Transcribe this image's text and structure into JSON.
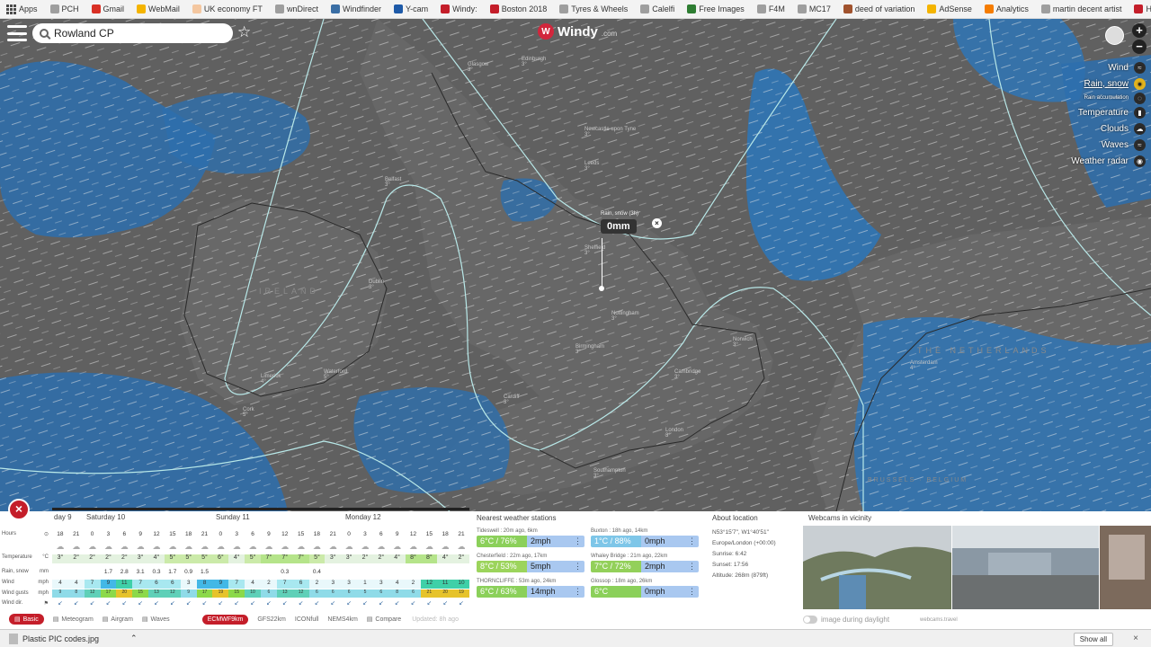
{
  "bookmarks": [
    {
      "label": "Apps",
      "color": "#4a4a4a",
      "icon": "apps-grid-icon"
    },
    {
      "label": "PCH",
      "color": "#9e9e9e",
      "icon": "page-icon"
    },
    {
      "label": "Gmail",
      "color": "#d93025",
      "icon": "gmail-icon"
    },
    {
      "label": "WebMail",
      "color": "#f4b400",
      "icon": "webmail-icon"
    },
    {
      "label": "UK economy FT",
      "color": "#f4c7a0",
      "icon": "ft-icon"
    },
    {
      "label": "wnDirect",
      "color": "#9e9e9e",
      "icon": "page-icon"
    },
    {
      "label": "Windfinder",
      "color": "#3a6ea5",
      "icon": "windfinder-icon"
    },
    {
      "label": "Y-cam",
      "color": "#1e5aa8",
      "icon": "ycam-icon"
    },
    {
      "label": "Windy:",
      "color": "#c41e2a",
      "icon": "windy-icon"
    },
    {
      "label": "Boston 2018",
      "color": "#c41e2a",
      "icon": "map-pin-icon"
    },
    {
      "label": "Tyres & Wheels",
      "color": "#9e9e9e",
      "icon": "page-icon"
    },
    {
      "label": "Calelfi",
      "color": "#9e9e9e",
      "icon": "page-icon"
    },
    {
      "label": "Free Images",
      "color": "#2e7d32",
      "icon": "images-icon"
    },
    {
      "label": "F4M",
      "color": "#9e9e9e",
      "icon": "page-icon"
    },
    {
      "label": "MC17",
      "color": "#9e9e9e",
      "icon": "page-icon"
    },
    {
      "label": "deed of variation",
      "color": "#a0522d",
      "icon": "deed-icon"
    },
    {
      "label": "AdSense",
      "color": "#f4b400",
      "icon": "adsense-icon"
    },
    {
      "label": "Analytics",
      "color": "#f57c00",
      "icon": "analytics-icon"
    },
    {
      "label": "martin decent artist",
      "color": "#9e9e9e",
      "icon": "page-icon"
    },
    {
      "label": "How to set up a rout",
      "color": "#c41e2a",
      "icon": "poa-icon"
    }
  ],
  "search": {
    "value": "Rowland CP"
  },
  "logo": {
    "text": "Windy",
    "suffix": ".com"
  },
  "zoom": {
    "in": "+",
    "out": "−"
  },
  "layers": [
    {
      "label": "Wind",
      "icon": "wind-icon",
      "glyph": "≈",
      "active": false,
      "small": false
    },
    {
      "label": "Rain, snow",
      "icon": "rain-drop-icon",
      "glyph": "●",
      "active": true,
      "small": false
    },
    {
      "label": "Rain accumulation",
      "icon": "rain-accumulation-icon",
      "glyph": "◌",
      "active": false,
      "small": true
    },
    {
      "label": "Temperature",
      "icon": "thermometer-icon",
      "glyph": "▮",
      "active": false,
      "small": false
    },
    {
      "label": "Clouds",
      "icon": "cloud-icon",
      "glyph": "☁",
      "active": false,
      "small": false
    },
    {
      "label": "Waves",
      "icon": "waves-icon",
      "glyph": "≈",
      "active": false,
      "small": false
    },
    {
      "label": "Weather radar",
      "icon": "radar-icon",
      "glyph": "◉",
      "active": false,
      "small": false
    }
  ],
  "popup": {
    "title": "Rain, snow (3h)",
    "value": "0mm",
    "close": "×"
  },
  "map_labels": {
    "countries": [
      "IRELAND",
      "THE NETHERLANDS",
      "BRUSSELS · BELGIUM"
    ],
    "cities": [
      {
        "name": "Glasgow",
        "temp": "3°"
      },
      {
        "name": "Edinburgh",
        "temp": "3°"
      },
      {
        "name": "Newcastle upon Tyne",
        "temp": "3°"
      },
      {
        "name": "Belfast",
        "temp": "3°"
      },
      {
        "name": "Leeds",
        "temp": "3°"
      },
      {
        "name": "Sheffield",
        "temp": "3°"
      },
      {
        "name": "Dublin",
        "temp": "3°"
      },
      {
        "name": "Nottingham",
        "temp": "3°"
      },
      {
        "name": "Birmingham",
        "temp": "3°"
      },
      {
        "name": "Cardiff",
        "temp": "3°"
      },
      {
        "name": "London",
        "temp": "3°"
      },
      {
        "name": "Cork",
        "temp": "5°"
      },
      {
        "name": "Amsterdam",
        "temp": "4°"
      },
      {
        "name": "Norwich",
        "temp": "3°"
      },
      {
        "name": "Cambridge",
        "temp": "3°"
      },
      {
        "name": "Limerick",
        "temp": "4°"
      },
      {
        "name": "Waterford",
        "temp": "5°"
      },
      {
        "name": "Southampton",
        "temp": "3°"
      }
    ]
  },
  "forecast": {
    "close": "×",
    "days": [
      "day 9",
      "Saturday 10",
      "Sunday 11",
      "Monday 12"
    ],
    "row_labels": [
      {
        "name": "Hours",
        "unit": "⊙"
      },
      {
        "name": "Temperature",
        "unit": "°C"
      },
      {
        "name": "Rain, snow",
        "unit": "mm"
      },
      {
        "name": "Wind",
        "unit": "mph"
      },
      {
        "name": "Wind gusts",
        "unit": "mph"
      },
      {
        "name": "Wind dir.",
        "unit": "⚑"
      }
    ],
    "hours": [
      "18",
      "21",
      "0",
      "3",
      "6",
      "9",
      "12",
      "15",
      "18",
      "21",
      "0",
      "3",
      "6",
      "9",
      "12",
      "15",
      "18",
      "21",
      "0",
      "3",
      "6",
      "9",
      "12",
      "15",
      "18",
      "21"
    ],
    "temps": [
      "3°",
      "2°",
      "2°",
      "2°",
      "2°",
      "3°",
      "4°",
      "5°",
      "5°",
      "5°",
      "6°",
      "4°",
      "5°",
      "7°",
      "7°",
      "7°",
      "5°",
      "3°",
      "3°",
      "2°",
      "2°",
      "4°",
      "8°",
      "8°",
      "4°",
      "2°"
    ],
    "rain": [
      "",
      "",
      "",
      "1.7",
      "2.8",
      "3.1",
      "0.3",
      "1.7",
      "0.9",
      "1.5",
      "",
      "",
      "",
      "",
      "0.3",
      "",
      "0.4",
      "",
      "",
      "",
      "",
      "",
      "",
      "",
      "",
      ""
    ],
    "wind": [
      "4",
      "4",
      "7",
      "9",
      "11",
      "7",
      "6",
      "6",
      "3",
      "8",
      "9",
      "7",
      "4",
      "2",
      "7",
      "6",
      "2",
      "3",
      "3",
      "1",
      "3",
      "4",
      "2",
      "12",
      "11",
      "10"
    ],
    "gusts": [
      "9",
      "8",
      "12",
      "17",
      "20",
      "15",
      "13",
      "12",
      "9",
      "17",
      "19",
      "15",
      "10",
      "6",
      "13",
      "12",
      "6",
      "6",
      "6",
      "5",
      "6",
      "8",
      "6",
      "21",
      "20",
      "19"
    ]
  },
  "stations": {
    "title": "Nearest weather stations",
    "items": [
      {
        "name": "Tideswell : 20m ago, 6km",
        "temp": "6°C / 76%",
        "wind": "2mph",
        "color": "#8bd05a"
      },
      {
        "name": "Buxton : 18h ago, 14km",
        "temp": "1°C / 88%",
        "wind": "0mph",
        "color": "#7ec6e8"
      },
      {
        "name": "Chesterfield : 22m ago, 17km",
        "temp": "8°C / 53%",
        "wind": "5mph",
        "color": "#9cd45c"
      },
      {
        "name": "Whaley Bridge : 21m ago, 22km",
        "temp": "7°C / 72%",
        "wind": "2mph",
        "color": "#93d05a"
      },
      {
        "name": "THORNCLIFFE : 53m ago, 24km",
        "temp": "6°C / 63%",
        "wind": "14mph",
        "color": "#8bd05a"
      },
      {
        "name": "Glossop : 18m ago, 26km",
        "temp": "6°C",
        "wind": "0mph",
        "color": "#8bd05a"
      }
    ]
  },
  "about": {
    "title": "About location",
    "lines": [
      "N53°15'7\", W1°40'51\"",
      "Europe/London (+00:00)",
      "Sunrise: 6:42",
      "Sunset: 17:56",
      "Altitude: 268m (879ft)"
    ]
  },
  "webcams": {
    "title": "Webcams in vicinity",
    "daylight": "image during daylight",
    "credit": "webcams.travel"
  },
  "footer_tabs": [
    {
      "label": "Basic",
      "active": true,
      "icon": "basic-icon"
    },
    {
      "label": "Meteogram",
      "active": false,
      "icon": "meteogram-icon"
    },
    {
      "label": "Airgram",
      "active": false,
      "icon": "airgram-icon"
    },
    {
      "label": "Waves",
      "active": false,
      "icon": "waves-tab-icon"
    }
  ],
  "models": {
    "items": [
      "ECMWF9km",
      "GFS22km",
      "ICONfull",
      "NEMS4km"
    ],
    "active": "ECMWF9km",
    "compare": "Compare",
    "updated": "Updated: 8h ago"
  },
  "downloads": {
    "file": "Plastic PIC codes.jpg",
    "show_all": "Show all",
    "close": "×"
  }
}
